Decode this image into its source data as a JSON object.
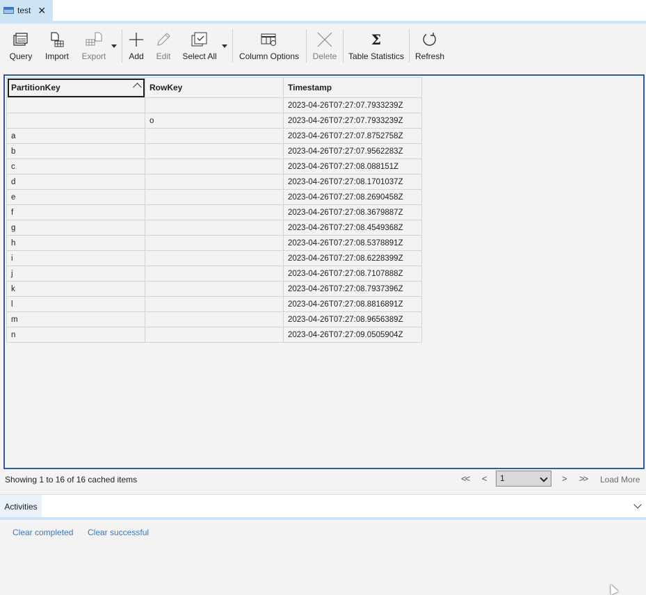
{
  "tab": {
    "label": "test",
    "close": "✕"
  },
  "toolbar": {
    "query": "Query",
    "import": "Import",
    "export": "Export",
    "add": "Add",
    "edit": "Edit",
    "select_all": "Select All",
    "column_options": "Column Options",
    "delete": "Delete",
    "table_statistics": "Table Statistics",
    "refresh": "Refresh"
  },
  "grid": {
    "columns": [
      "PartitionKey",
      "RowKey",
      "Timestamp"
    ],
    "rows": [
      [
        "",
        "",
        "2023-04-26T07:27:07.7933239Z"
      ],
      [
        "",
        "o",
        "2023-04-26T07:27:07.7933239Z"
      ],
      [
        "a",
        "",
        "2023-04-26T07:27:07.8752758Z"
      ],
      [
        "b",
        "",
        "2023-04-26T07:27:07.9562283Z"
      ],
      [
        "c",
        "",
        "2023-04-26T07:27:08.088151Z"
      ],
      [
        "d",
        "",
        "2023-04-26T07:27:08.1701037Z"
      ],
      [
        "e",
        "",
        "2023-04-26T07:27:08.2690458Z"
      ],
      [
        "f",
        "",
        "2023-04-26T07:27:08.3679887Z"
      ],
      [
        "g",
        "",
        "2023-04-26T07:27:08.4549368Z"
      ],
      [
        "h",
        "",
        "2023-04-26T07:27:08.5378891Z"
      ],
      [
        "i",
        "",
        "2023-04-26T07:27:08.6228399Z"
      ],
      [
        "j",
        "",
        "2023-04-26T07:27:08.7107888Z"
      ],
      [
        "k",
        "",
        "2023-04-26T07:27:08.7937396Z"
      ],
      [
        "l",
        "",
        "2023-04-26T07:27:08.8816891Z"
      ],
      [
        "m",
        "",
        "2023-04-26T07:27:08.9656389Z"
      ],
      [
        "n",
        "",
        "2023-04-26T07:27:09.0505904Z"
      ]
    ]
  },
  "status": {
    "text": "Showing 1 to 16 of 16 cached items"
  },
  "pager": {
    "first": "<<",
    "prev": "<",
    "next": ">",
    "last": ">>",
    "page": "1",
    "load_more": "Load More"
  },
  "activities": {
    "tab": "Activities",
    "clear_completed": "Clear completed",
    "clear_successful": "Clear successful"
  }
}
